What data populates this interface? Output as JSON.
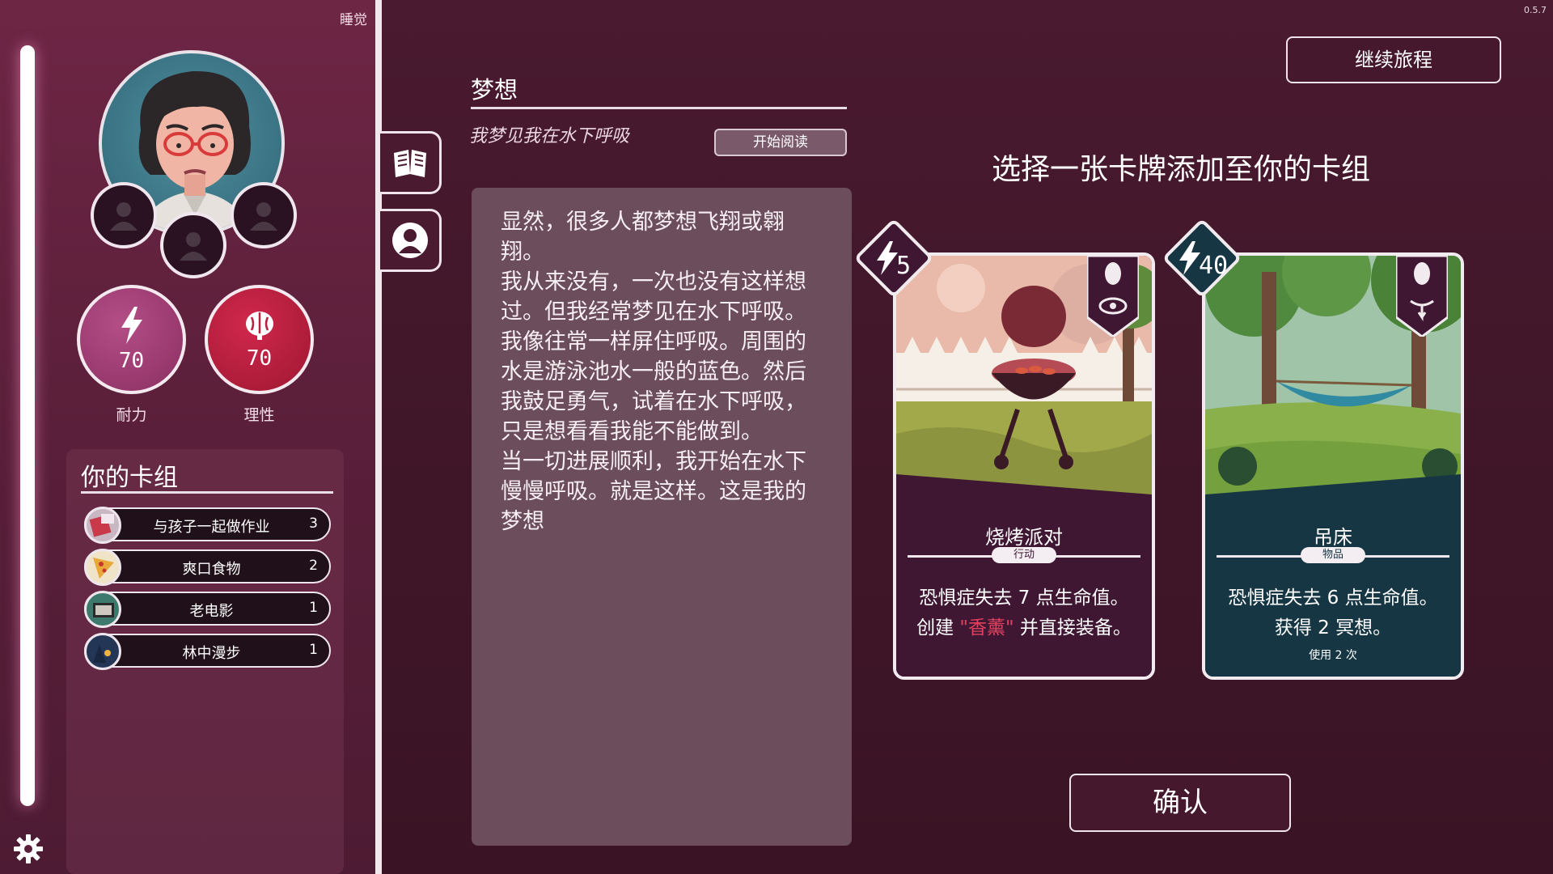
{
  "version": "0.5.7",
  "sidebar": {
    "sleep_label": "睡觉",
    "stats": [
      {
        "label": "耐力",
        "value": "70",
        "icon": "lightning-icon",
        "color": "#a23d76"
      },
      {
        "label": "理性",
        "value": "70",
        "icon": "brain-icon",
        "color": "#b7203f"
      }
    ],
    "deck": {
      "title": "你的卡组",
      "items": [
        {
          "name": "与孩子一起做作业",
          "count": "3"
        },
        {
          "name": "爽口食物",
          "count": "2"
        },
        {
          "name": "老电影",
          "count": "1"
        },
        {
          "name": "林中漫步",
          "count": "1"
        }
      ]
    }
  },
  "dream": {
    "title": "梦想",
    "subtitle": "我梦见我在水下呼吸",
    "read_button": "开始阅读",
    "text": "显然，很多人都梦想飞翔或翱\n翔。\n我从来没有，一次也没有这样想\n过。但我经常梦见在水下呼吸。\n我像往常一样屏住呼吸。周围的\n水是游泳池水一般的蓝色。然后\n我鼓足勇气，试着在水下呼吸，\n只是想看看我能不能做到。\n当一切进展顺利，我开始在水下\n慢慢呼吸。就是这样。这是我的\n梦想"
  },
  "selection": {
    "continue_button": "继续旅程",
    "title": "选择一张卡牌添加至你的卡组",
    "confirm_button": "确认",
    "cards": [
      {
        "cost": "5",
        "name": "烧烤派对",
        "type": "行动",
        "desc_line1": "恐惧症失去 7  点生命值。",
        "desc_line2_prefix": "创建 ",
        "desc_line2_highlight": "\"香薰\"",
        "desc_line2_suffix": " 并直接装备。",
        "color": "#3f1733",
        "highlight_color": "#e2415f"
      },
      {
        "cost": "40",
        "name": "吊床",
        "type": "物品",
        "desc_line1": "恐惧症失去 6  点生命值。",
        "desc_line2": "获得 2 冥想。",
        "uses": "使用  2  次",
        "color": "#163644"
      }
    ]
  }
}
